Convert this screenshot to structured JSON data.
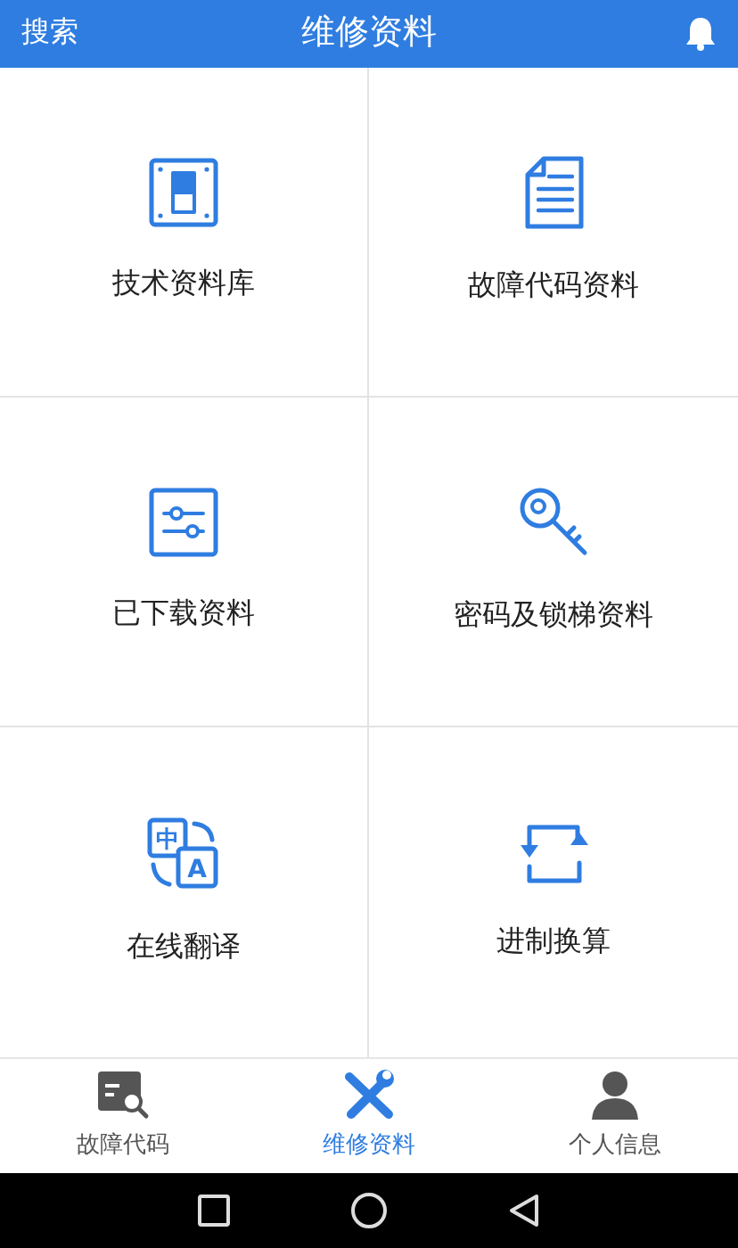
{
  "header": {
    "search": "搜索",
    "title": "维修资料"
  },
  "tiles": [
    {
      "kind": "manual",
      "label": "技术资料库"
    },
    {
      "kind": "document",
      "label": "故障代码资料"
    },
    {
      "kind": "sliders",
      "label": "已下载资料"
    },
    {
      "kind": "key",
      "label": "密码及锁梯资料"
    },
    {
      "kind": "translate",
      "label": "在线翻译",
      "glyphs": [
        "中",
        "A"
      ]
    },
    {
      "kind": "convert",
      "label": "进制换算"
    }
  ],
  "bottom_nav": [
    {
      "kind": "code",
      "label": "故障代码",
      "selected": false
    },
    {
      "kind": "tools",
      "label": "维修资料",
      "selected": true
    },
    {
      "kind": "person",
      "label": "个人信息",
      "selected": false
    }
  ]
}
